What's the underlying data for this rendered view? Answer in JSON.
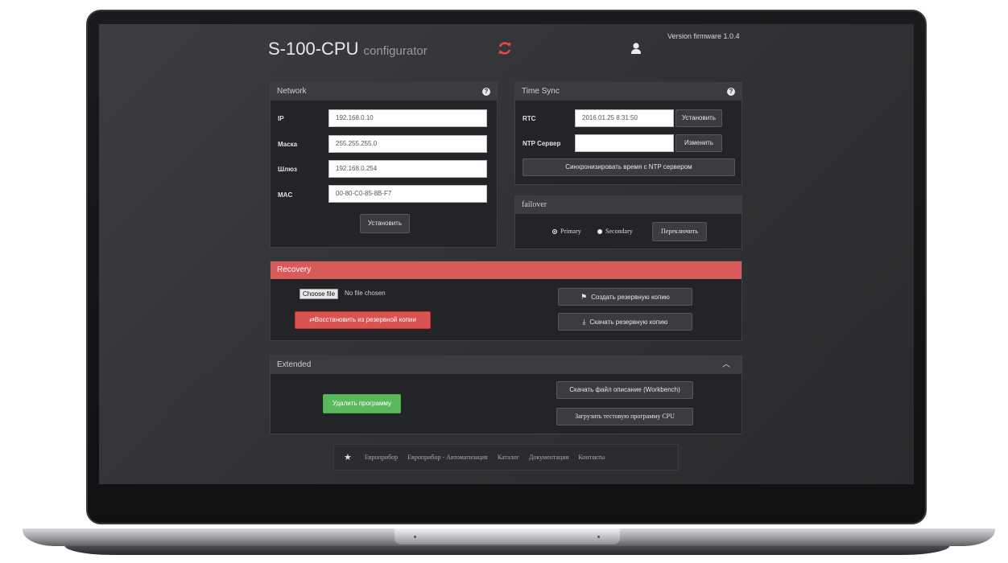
{
  "header": {
    "title": "S-100-CPU",
    "subtitle": "configurator",
    "version": "Version firmware 1.0.4"
  },
  "network": {
    "title": "Network",
    "fields": [
      {
        "label": "IP",
        "value": "192.168.0.10"
      },
      {
        "label": "Маска",
        "value": "255.255.255.0"
      },
      {
        "label": "Шлюз",
        "value": "192.168.0.254"
      },
      {
        "label": "MAC",
        "value": "00-80-C0-85-8B-F7"
      }
    ],
    "submit_label": "Установить"
  },
  "time_sync": {
    "title": "Time Sync",
    "rtc_label": "RTC",
    "rtc_value": "2016.01.25 8:31:50",
    "rtc_button": "Установить",
    "ntp_label": "NTP Сервер",
    "ntp_value": "",
    "ntp_button": "Изменить",
    "sync_button": "Синхронизировать время с NTP сервером"
  },
  "failover": {
    "title": "failover",
    "options": [
      "Primary",
      "Secondary"
    ],
    "selected": "Primary",
    "switch_button": "Переключить"
  },
  "recovery": {
    "title": "Recovery",
    "file_button": "Choose file",
    "file_status": "No file chosen",
    "restore_button": "Восстановить из резервной копии",
    "create_backup_button": "Создать резервную копию",
    "download_backup_button": "Скачать резервную копию"
  },
  "extended": {
    "title": "Extended",
    "delete_program_button": "Удалить программу",
    "download_description_button": "Скачать файл описание (Workbench)",
    "load_test_program_button": "Загрузить тестовую программу CPU"
  },
  "footer": {
    "links": [
      "Европрибор",
      "Европрибор - Автоматизация",
      "Каталог",
      "Документация",
      "Контакты"
    ]
  },
  "colors": {
    "recovery_accent": "#d95b59",
    "danger": "#d9534f",
    "success": "#5cb85c",
    "refresh_icon": "#e0484a"
  }
}
